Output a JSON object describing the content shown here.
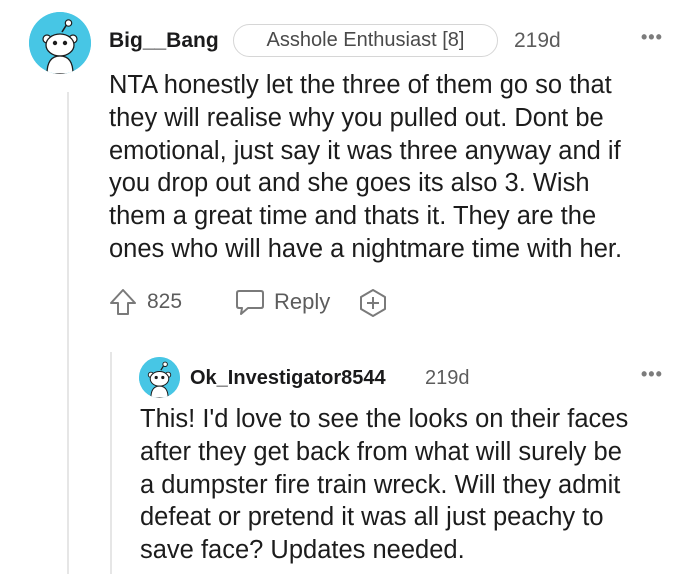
{
  "comment": {
    "author": "Big__Bang",
    "flair": "Asshole Enthusiast [8]",
    "age": "219d",
    "menu": "•••",
    "body": "NTA honestly let the three of them go so that\nthey will realise why you pulled out. Dont be\nemotional, just say it was three anyway and if\nyou drop out and she goes its also 3. Wish\nthem a great time and thats it. They are the\nones who will have a nightmare time with her.",
    "votes": "825",
    "reply_label": "Reply"
  },
  "reply": {
    "author": "Ok_Investigator8544",
    "age": "219d",
    "menu": "•••",
    "body": "This! I'd love to see the looks on their faces\nafter they get back from what will surely be\na dumpster fire train wreck. Will they admit\ndefeat or pretend it was all just peachy to\nsave face? Updates needed."
  },
  "colors": {
    "avatar_bg": "#47c6e5",
    "text": "#1c1c1c",
    "muted": "#5c5c5c"
  }
}
